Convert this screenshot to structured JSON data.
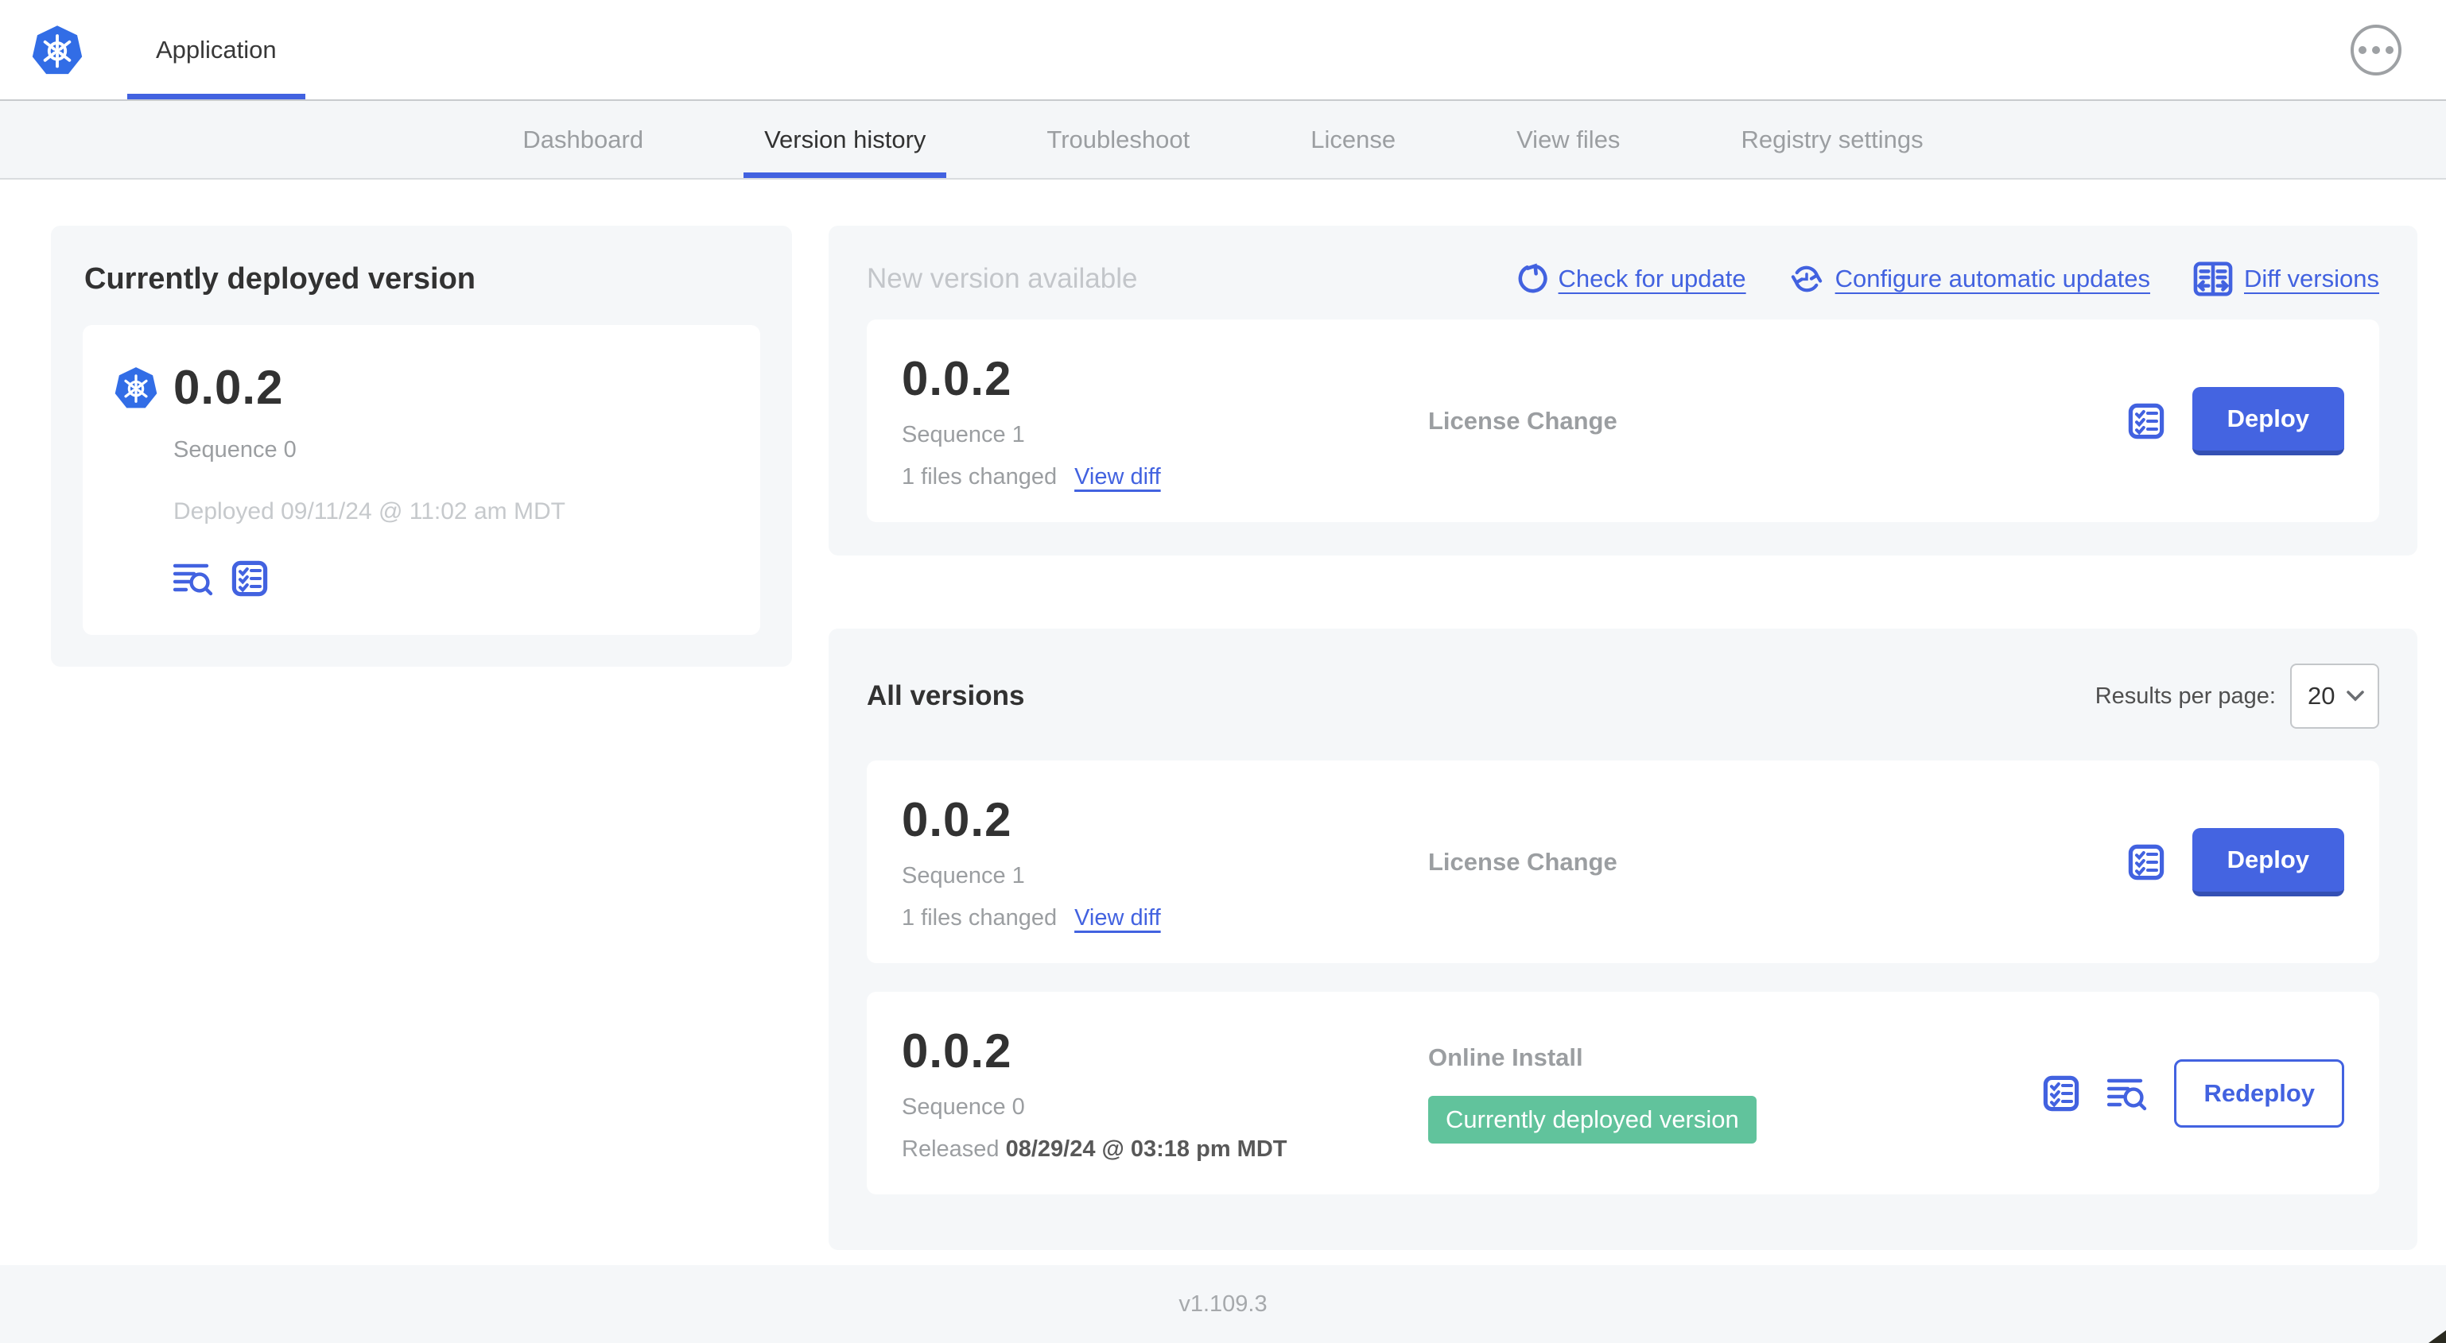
{
  "header": {
    "app_name": "Application"
  },
  "nav": {
    "tabs": [
      {
        "label": "Dashboard",
        "active": false
      },
      {
        "label": "Version history",
        "active": true
      },
      {
        "label": "Troubleshoot",
        "active": false
      },
      {
        "label": "License",
        "active": false
      },
      {
        "label": "View files",
        "active": false
      },
      {
        "label": "Registry settings",
        "active": false
      }
    ]
  },
  "current": {
    "title": "Currently deployed version",
    "version": "0.0.2",
    "sequence": "Sequence 0",
    "deployed_at": "Deployed 09/11/24 @ 11:02 am MDT",
    "icons": [
      "logs-icon",
      "config-checklist-icon"
    ]
  },
  "new_version": {
    "title": "New version available",
    "actions": [
      {
        "label": "Check for update",
        "icon": "refresh-icon"
      },
      {
        "label": "Configure automatic updates",
        "icon": "auto-update-clock-icon"
      },
      {
        "label": "Diff versions",
        "icon": "diff-icon"
      }
    ],
    "card": {
      "version": "0.0.2",
      "sequence": "Sequence 1",
      "files_changed": "1 files changed",
      "view_diff_label": "View diff",
      "source": "License Change",
      "action_label": "Deploy"
    }
  },
  "all_versions": {
    "title": "All versions",
    "results_per_page_label": "Results per page:",
    "results_per_page_value": "20",
    "rows": [
      {
        "version": "0.0.2",
        "sequence": "Sequence 1",
        "files_changed": "1 files changed",
        "view_diff_label": "View diff",
        "source": "License Change",
        "action_label": "Deploy"
      },
      {
        "version": "0.0.2",
        "sequence": "Sequence 0",
        "released_prefix": "Released",
        "released_date": "08/29/24 @ 03:18 pm MDT",
        "source": "Online Install",
        "badge": "Currently deployed version",
        "action_label": "Redeploy"
      }
    ]
  },
  "footer": {
    "app_manager_version": "v1.109.3"
  },
  "colors": {
    "accent_blue": "#4262e0",
    "kubernetes_blue": "#326de6",
    "badge_green": "#61c39c",
    "panel_gray": "#f5f7f9"
  }
}
